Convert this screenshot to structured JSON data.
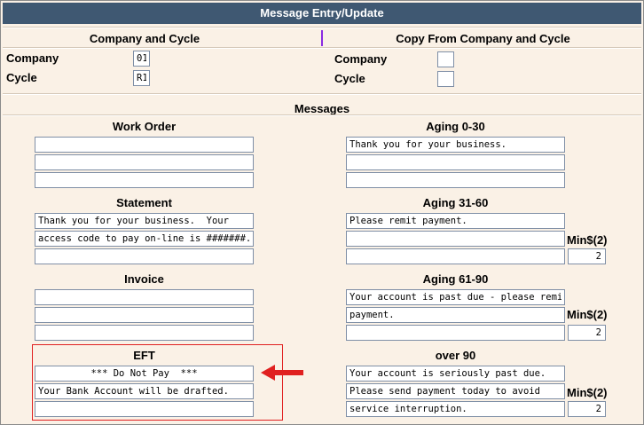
{
  "window": {
    "title": "Message Entry/Update"
  },
  "company_cycle": {
    "header": "Company and Cycle",
    "company_label": "Company",
    "company_value": "01",
    "cycle_label": "Cycle",
    "cycle_value": "R1"
  },
  "copy_from": {
    "header": "Copy From Company and Cycle",
    "company_label": "Company",
    "company_value": "",
    "cycle_label": "Cycle",
    "cycle_value": ""
  },
  "messages": {
    "header": "Messages",
    "work_order": {
      "title": "Work Order",
      "lines": [
        "",
        "",
        ""
      ]
    },
    "statement": {
      "title": "Statement",
      "lines": [
        "Thank you for your business.  Your",
        "access code to pay on-line is #######.",
        ""
      ]
    },
    "invoice": {
      "title": "Invoice",
      "lines": [
        "",
        "",
        ""
      ]
    },
    "eft": {
      "title": "EFT",
      "lines": [
        "*** Do Not Pay  ***",
        "Your Bank Account will be drafted.",
        ""
      ]
    },
    "aging_0_30": {
      "title": "Aging 0-30",
      "lines": [
        "Thank you for your business.",
        "",
        ""
      ]
    },
    "aging_31_60": {
      "title": "Aging 31-60",
      "lines": [
        "Please remit payment.",
        "",
        ""
      ],
      "min_label": "Min$(2)",
      "min_value": "2"
    },
    "aging_61_90": {
      "title": "Aging 61-90",
      "lines": [
        "Your account is past due - please remit",
        "payment.",
        ""
      ],
      "min_label": "Min$(2)",
      "min_value": "2"
    },
    "over_90": {
      "title": "over 90",
      "lines": [
        "Your account is seriously past due.",
        "Please send payment today to avoid",
        "service interruption."
      ],
      "min_label": "Min$(2)",
      "min_value": "2"
    }
  },
  "annotation": {
    "arrow_color": "#e02020",
    "eft_highlight_color": "#e02020",
    "arrow_icon": "left-arrow-icon"
  },
  "colors": {
    "titlebar": "#3f5872",
    "background": "#faf1e6",
    "input_border": "#7f8fa6"
  }
}
